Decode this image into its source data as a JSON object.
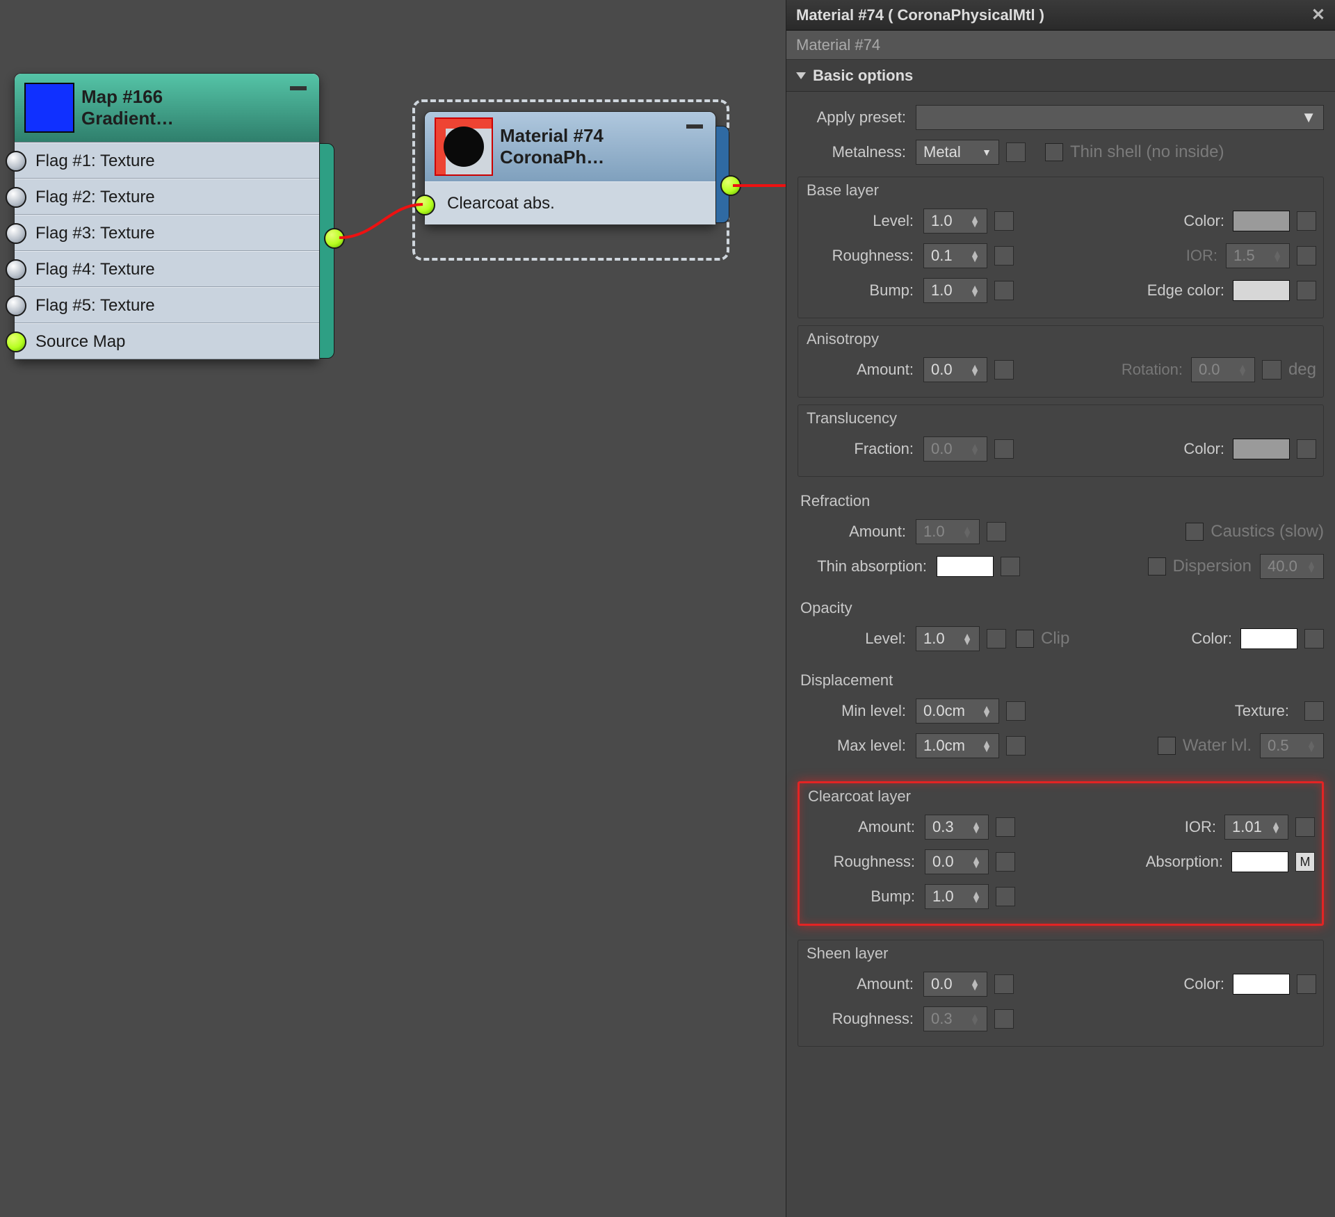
{
  "panel": {
    "title": "Material #74  ( CoronaPhysicalMtl )",
    "crumb": "Material #74",
    "rollup": "Basic options",
    "applyPreset": "Apply preset:",
    "metalnessLabel": "Metalness:",
    "metalnessValue": "Metal",
    "thinShell": "Thin shell (no inside)",
    "baseLayer": {
      "title": "Base layer",
      "levelLabel": "Level:",
      "level": "1.0",
      "colorLabel": "Color:",
      "roughLabel": "Roughness:",
      "rough": "0.1",
      "iorLabel": "IOR:",
      "ior": "1.5",
      "bumpLabel": "Bump:",
      "bump": "1.0",
      "edgeLabel": "Edge color:"
    },
    "aniso": {
      "title": "Anisotropy",
      "amountLabel": "Amount:",
      "amount": "0.0",
      "rotLabel": "Rotation:",
      "rot": "0.0",
      "deg": "deg"
    },
    "trans": {
      "title": "Translucency",
      "fracLabel": "Fraction:",
      "frac": "0.0",
      "colorLabel": "Color:"
    },
    "refraction": {
      "title": "Refraction",
      "amountLabel": "Amount:",
      "amount": "1.0",
      "caustics": "Caustics (slow)",
      "thinLabel": "Thin absorption:",
      "dispersion": "Dispersion",
      "dispVal": "40.0"
    },
    "opacity": {
      "title": "Opacity",
      "levelLabel": "Level:",
      "level": "1.0",
      "clip": "Clip",
      "colorLabel": "Color:"
    },
    "disp": {
      "title": "Displacement",
      "minLabel": "Min level:",
      "min": "0.0cm",
      "texLabel": "Texture:",
      "maxLabel": "Max level:",
      "max": "1.0cm",
      "waterLabel": "Water lvl.",
      "water": "0.5"
    },
    "clear": {
      "title": "Clearcoat layer",
      "amountLabel": "Amount:",
      "amount": "0.3",
      "iorLabel": "IOR:",
      "ior": "1.01",
      "roughLabel": "Roughness:",
      "rough": "0.0",
      "absLabel": "Absorption:",
      "absMap": "M",
      "bumpLabel": "Bump:",
      "bump": "1.0"
    },
    "sheen": {
      "title": "Sheen layer",
      "amountLabel": "Amount:",
      "amount": "0.0",
      "colorLabel": "Color:",
      "roughLabel": "Roughness:",
      "rough": "0.3"
    }
  },
  "nodes": {
    "gradient": {
      "title": "Map #166",
      "subtitle": "Gradient…",
      "rows": [
        "Flag #1: Texture",
        "Flag #2: Texture",
        "Flag #3: Texture",
        "Flag #4: Texture",
        "Flag #5: Texture",
        "Source Map"
      ]
    },
    "material": {
      "title": "Material #74",
      "subtitle": "CoronaPh…",
      "row": "Clearcoat abs."
    }
  },
  "colors": {
    "baseColor": "#9a9a9a",
    "edgeColor": "#d7d7d7",
    "transColor": "#9a9a9a",
    "thinAbs": "#ffffff",
    "opacityColor": "#ffffff",
    "clearAbs": "#ffffff",
    "sheenColor": "#ffffff"
  }
}
